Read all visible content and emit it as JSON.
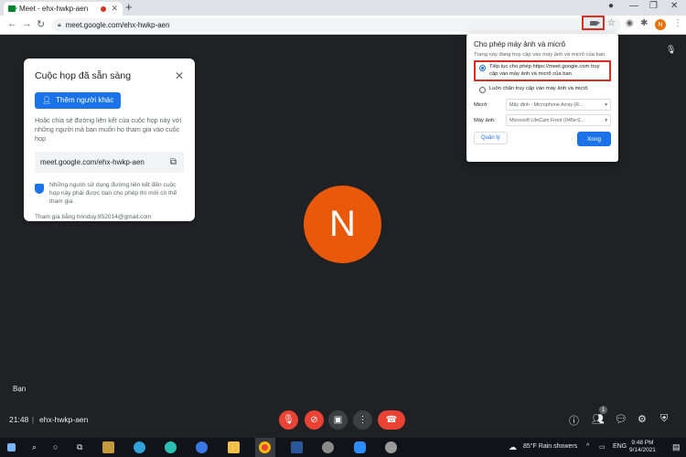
{
  "browser": {
    "tab_title": "Meet - ehx-hwkp-aen",
    "tab_close": "✕",
    "new_tab": "+",
    "url": "meet.google.com/ehx-hwkp-aen",
    "profile_initial": "N"
  },
  "ready_card": {
    "title": "Cuộc họp đã sẵn sàng",
    "add_button": "Thêm người khác",
    "description": "Hoặc chia sẻ đường liên kết của cuộc họp này với những người mà bạn muốn họ tham gia vào cuộc họp",
    "meeting_link": "meet.google.com/ehx-hwkp-aen",
    "security_note": "Những người sử dụng đường liên kết đến cuộc họp này phải được bạn cho phép thì mới có thể tham gia.",
    "joined_as": "Tham gia bằng hnnduy.952014@gmail.com"
  },
  "permission_popup": {
    "title": "Cho phép máy ảnh và micrô",
    "subtitle": "Trang này đang truy cập vào máy ảnh và micrô của bạn.",
    "option_allow": "Tiếp tục cho phép https://meet.google.com truy cập vào máy ảnh và micrô của bạn",
    "option_block": "Luôn chặn truy cập vào máy ảnh và micrô",
    "mic_label": "Micrô:",
    "mic_value": "Mặc định - Microphone Array (R...",
    "camera_label": "Máy ảnh:",
    "camera_value": "Microsoft LifeCam Front (045e:0...",
    "manage_button": "Quản lý",
    "done_button": "Xong"
  },
  "participant": {
    "avatar_initial": "N",
    "self_label": "Bạn"
  },
  "meet_bar": {
    "time": "21:48",
    "separator": "|",
    "meeting_code": "ehx-hwkp-aen",
    "participant_count": "1"
  },
  "taskbar": {
    "weather": "85°F  Rain showers",
    "language": "ENG",
    "time": "9:48 PM",
    "date": "9/14/2021"
  },
  "colors": {
    "meet_background": "#202124",
    "accent_blue": "#1a73e8",
    "avatar_orange": "#ea580c",
    "control_red": "#ea4335",
    "highlight_red": "#d93025"
  }
}
